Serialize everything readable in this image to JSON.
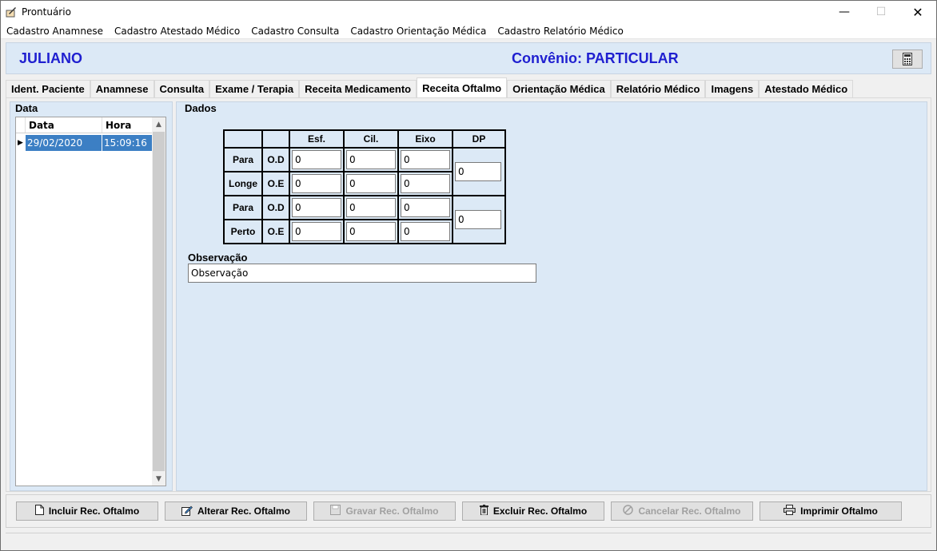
{
  "window": {
    "title": "Prontuário"
  },
  "menu": [
    "Cadastro Anamnese",
    "Cadastro Atestado Médico",
    "Cadastro Consulta",
    "Cadastro Orientação Médica",
    "Cadastro Relatório Médico"
  ],
  "header": {
    "patient": "JULIANO",
    "convenio": "Convênio: PARTICULAR"
  },
  "tabs": [
    "Ident. Paciente",
    "Anamnese",
    "Consulta",
    "Exame / Terapia",
    "Receita Medicamento",
    "Receita Oftalmo",
    "Orientação Médica",
    "Relatório Médico",
    "Imagens",
    "Atestado Médico"
  ],
  "active_tab": "Receita Oftalmo",
  "data_panel": {
    "label": "Data",
    "columns": [
      "Data",
      "Hora"
    ],
    "rows": [
      {
        "data": "29/02/2020",
        "hora": "15:09:16"
      }
    ]
  },
  "dados": {
    "label": "Dados",
    "cols": [
      "Esf.",
      "Cil.",
      "Eixo",
      "DP"
    ],
    "para": "Para",
    "longe": "Longe",
    "perto": "Perto",
    "od": "O.D",
    "oe": "O.E",
    "longe_od": {
      "esf": "0",
      "cil": "0",
      "eixo": "0"
    },
    "longe_oe": {
      "esf": "0",
      "cil": "0",
      "eixo": "0"
    },
    "perto_od": {
      "esf": "0",
      "cil": "0",
      "eixo": "0"
    },
    "perto_oe": {
      "esf": "0",
      "cil": "0",
      "eixo": "0"
    },
    "dp_longe": "0",
    "dp_perto": "0",
    "obs_label": "Observação",
    "obs_value": "Observação"
  },
  "buttons": {
    "incluir": "Incluir Rec. Oftalmo",
    "alterar": "Alterar Rec. Oftalmo",
    "gravar": "Gravar Rec. Oftalmo",
    "excluir": "Excluir Rec. Oftalmo",
    "cancelar": "Cancelar Rec. Oftalmo",
    "imprimir": "Imprimir Oftalmo"
  }
}
